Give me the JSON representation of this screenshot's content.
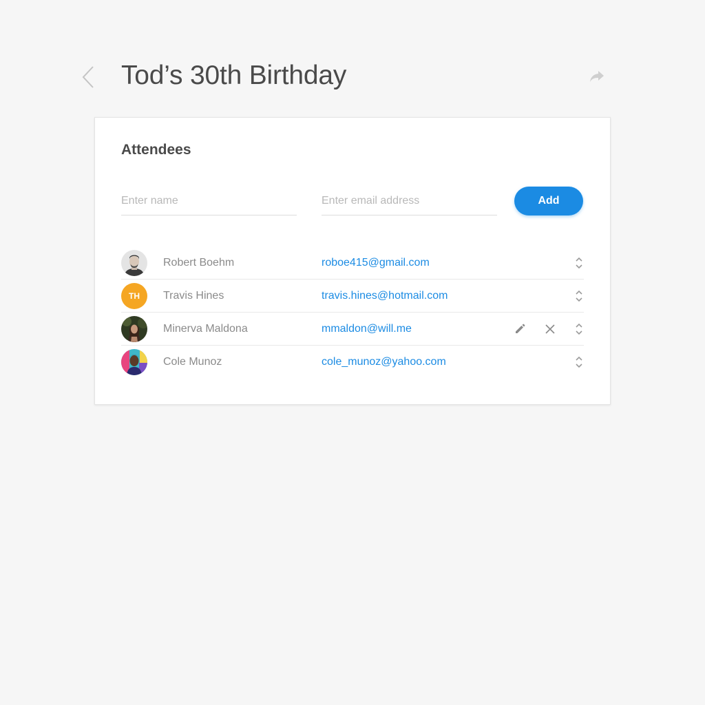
{
  "header": {
    "title": "Tod’s 30th Birthday",
    "back_icon": "chevron-left-icon",
    "share_icon": "share-arrow-icon"
  },
  "attendees": {
    "heading": "Attendees",
    "name_placeholder": "Enter name",
    "email_placeholder": "Enter email address",
    "add_label": "Add",
    "list": [
      {
        "name": "Robert Boehm",
        "email": "roboe415@gmail.com",
        "avatar": "photo"
      },
      {
        "name": "Travis Hines",
        "email": "travis.hines@hotmail.com",
        "avatar": "initials",
        "initials": "TH",
        "avatar_color": "#f5a623"
      },
      {
        "name": "Minerva Maldona",
        "email": "mmaldon@will.me",
        "avatar": "photo",
        "actions": [
          "pencil-icon",
          "close-icon"
        ]
      },
      {
        "name": "Cole Munoz",
        "email": "cole_munoz@yahoo.com",
        "avatar": "photo"
      }
    ]
  },
  "colors": {
    "accent": "#1b8be3",
    "background": "#f6f6f6",
    "card": "#ffffff",
    "title_text": "#4a4a4a",
    "muted_text": "#8a8a8a"
  }
}
